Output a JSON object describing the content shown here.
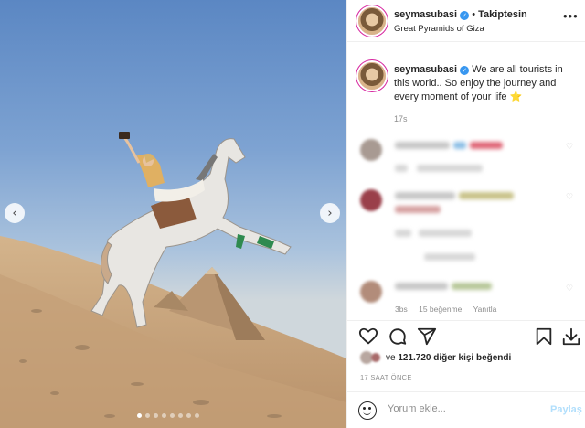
{
  "header": {
    "username": "seymasubasi",
    "verified_mark": "✓",
    "bullet": "•",
    "follow_label": "Takiptesin",
    "location": "Great Pyramids of Giza",
    "more_label": "•••"
  },
  "caption": {
    "username": "seymasubasi",
    "text": "We are all tourists in this world.. So enjoy the journey and every moment of your life",
    "emoji": "⭐",
    "time": "17s"
  },
  "comments": {
    "last_meta": {
      "time": "3bs",
      "likes": "15 beğenme",
      "reply": "Yanıtla"
    }
  },
  "actions": {
    "like": "heart-icon",
    "comment": "comment-icon",
    "share": "share-icon",
    "save": "bookmark-icon",
    "download": "download-icon"
  },
  "likes": {
    "prefix": "ve",
    "count": "121.720",
    "suffix": "diğer kişi beğendi"
  },
  "timestamp": "17 SAAT ÖNCE",
  "composer": {
    "placeholder": "Yorum ekle...",
    "post_label": "Paylaş"
  },
  "carousel": {
    "prev": "‹",
    "next": "›",
    "dots_total": 8,
    "active_dot": 0
  },
  "colors": {
    "accent": "#3897f0",
    "post_disabled": "#b2dffc",
    "muted": "#8e8e8e"
  }
}
